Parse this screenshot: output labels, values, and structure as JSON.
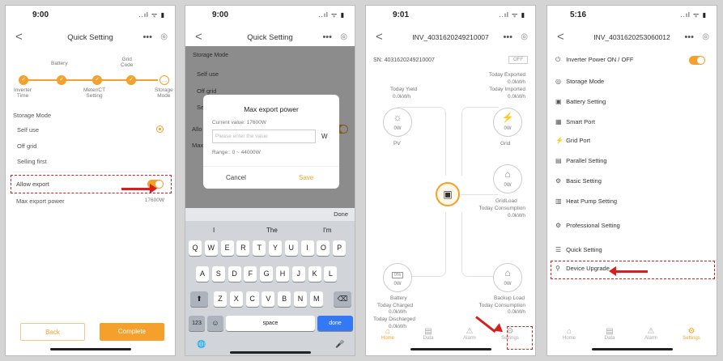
{
  "p1": {
    "time": "9:00",
    "status_icons": "..ıl ᯤ ▮",
    "title": "Quick Setting",
    "more": "•••",
    "close": "◎",
    "back": "<",
    "steps_top": [
      "Battery",
      "Grid\nCode"
    ],
    "steps_bottom": [
      "Inverter\nTime",
      "Meter/CT\nSetting",
      "Storage\nMode"
    ],
    "storage_mode_label": "Storage Mode",
    "options": [
      "Self use",
      "Off grid",
      "Selling first"
    ],
    "allow_export": "Allow export",
    "max_export": "Max export power",
    "max_export_value": "17600W",
    "back_btn": "Back",
    "complete_btn": "Complete"
  },
  "p2": {
    "time": "9:00",
    "status_icons": "..ıl ᯤ ▮",
    "title": "Quick Setting",
    "more": "•••",
    "close": "◎",
    "back": "<",
    "storage_mode_label": "Storage Mode",
    "options": [
      "Self use",
      "Off grid",
      "Se"
    ],
    "allow_label": "Allo",
    "max_label": "Max",
    "dialog_title": "Max export power",
    "current_value": "Current value: 17600W",
    "placeholder": "Please enter the value",
    "unit": "W",
    "range": "Range : 0 ~ 44000W",
    "cancel": "Cancel",
    "save": "Save",
    "done": "Done",
    "suggestions": [
      "I",
      "The",
      "I'm"
    ],
    "row1": [
      "Q",
      "W",
      "E",
      "R",
      "T",
      "Y",
      "U",
      "I",
      "O",
      "P"
    ],
    "row2": [
      "A",
      "S",
      "D",
      "F",
      "G",
      "H",
      "J",
      "K",
      "L"
    ],
    "row3": [
      "Z",
      "X",
      "C",
      "V",
      "B",
      "N",
      "M"
    ],
    "shift": "⬆",
    "delete": "⌫",
    "num": "123",
    "emoji": "☺",
    "space": "space",
    "done_key": "done",
    "globe": "🌐",
    "mic": "🎤"
  },
  "p3": {
    "time": "9:01",
    "status_icons": "..ıl ᯤ ▮",
    "title": "INV_4031620249210007",
    "more": "•••",
    "close": "◎",
    "back": "<",
    "sn": "SN: 4031620249210007",
    "off": "OFF",
    "today_yield": "Today Yield",
    "yield_val": "0.0kWh",
    "pv_val": "0W",
    "pv": "PV",
    "today_exported": "Today Exported",
    "exported_val": "0.0kWh",
    "today_imported": "Today Imported",
    "imported_val": "0.0kWh",
    "grid_val": "0W",
    "grid": "Grid",
    "grid_load_val": "0W",
    "grid_load": "GridLoad",
    "today_consumption": "Today Consumption",
    "grid_cons_val": "0.0kWh",
    "battery_pct": "0%",
    "battery_val": "0W",
    "battery": "Battery",
    "today_charged": "Today Charged",
    "charged_val": "0.0kWh",
    "today_discharged": "Today Discharged",
    "discharged_val": "0.0kWh",
    "backup_val": "0W",
    "backup": "Backup Load",
    "backup_cons": "Today Consumption",
    "backup_cons_val": "0.0kWh",
    "tabs": [
      "Home",
      "Data",
      "Alarm",
      "Settings"
    ]
  },
  "p4": {
    "time": "5:16",
    "status_icons": "..ıl ᯤ ▮",
    "title": "INV_4031620253060012",
    "more": "•••",
    "close": "◎",
    "back": "<",
    "items": [
      "Inverter Power ON / OFF",
      "Storage Mode",
      "Battery Setting",
      "Smart Port",
      "Grid Port",
      "Parallel Setting",
      "Basic Setting",
      "Heat Pump Setting",
      "Professional Setting",
      "Quick Setting",
      "Device Upgrade"
    ],
    "icons": [
      "⏻",
      "◎",
      "▣",
      "▦",
      "⚡",
      "▤",
      "⚙",
      "▥",
      "⚙",
      "☰",
      "⚲"
    ],
    "tabs": [
      "Home",
      "Data",
      "Alarm",
      "Settings"
    ]
  }
}
